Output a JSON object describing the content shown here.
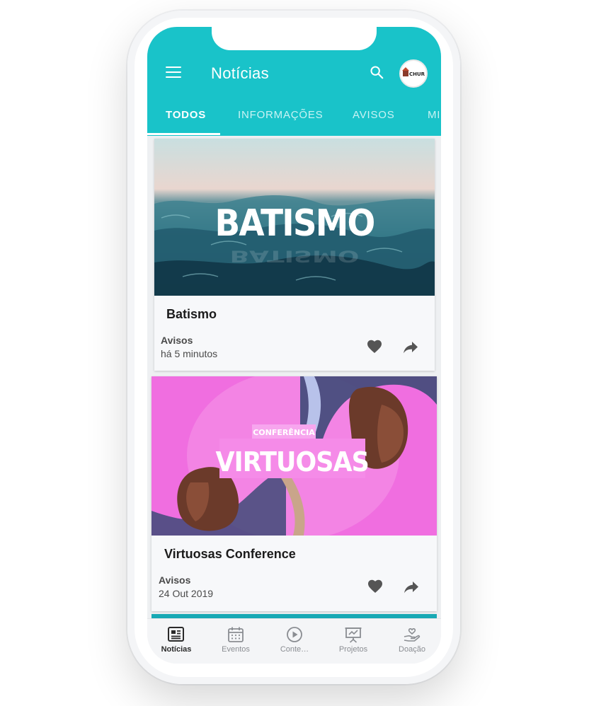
{
  "appbar": {
    "title": "Notícias",
    "menu_icon": "hamburger-menu-icon",
    "search_icon": "search-icon",
    "avatar_text": "CHURCH"
  },
  "tabs": [
    {
      "label": "TODOS",
      "active": true
    },
    {
      "label": "INFORMAÇÕES",
      "active": false
    },
    {
      "label": "AVISOS",
      "active": false
    },
    {
      "label": "MI",
      "active": false
    }
  ],
  "feed": [
    {
      "image_text": "BATISMO",
      "title": "Batismo",
      "category": "Avisos",
      "time": "há 5 minutos"
    },
    {
      "image_text_small": "CONFERÊNCIA",
      "image_text": "VIRTUOSAS",
      "title": "Virtuosas Conference",
      "category": "Avisos",
      "time": "24 Out 2019"
    }
  ],
  "bottom_nav": [
    {
      "label": "Notícias",
      "icon": "newspaper-icon",
      "active": true
    },
    {
      "label": "Eventos",
      "icon": "calendar-icon",
      "active": false
    },
    {
      "label": "Conte…",
      "icon": "play-circle-icon",
      "active": false
    },
    {
      "label": "Projetos",
      "icon": "presentation-board-icon",
      "active": false
    },
    {
      "label": "Doação",
      "icon": "donation-hand-icon",
      "active": false
    }
  ],
  "colors": {
    "primary": "#19c3c9",
    "tab_inactive": "#c9f3f4",
    "card_bg": "#f7f8fa",
    "pink": "#f06ee0"
  }
}
